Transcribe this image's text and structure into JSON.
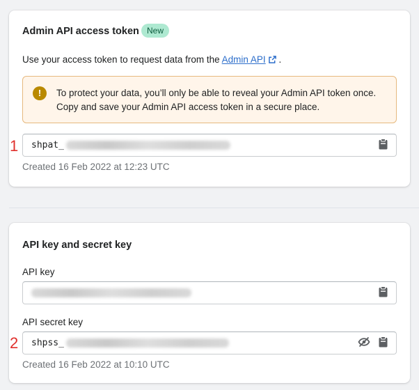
{
  "admin_token": {
    "title": "Admin API access token",
    "badge": "New",
    "description_prefix": "Use your access token to request data from the ",
    "description_link": "Admin API",
    "description_suffix": " .",
    "banner_text": "To protect your data, you’ll only be able to reveal your Admin API token once. Copy and save your Admin API access token in a secure place.",
    "token_prefix": "shpat_",
    "created": "Created 16 Feb 2022 at 12:23 UTC",
    "annotation": "1"
  },
  "api_keys": {
    "title": "API key and secret key",
    "api_key_label": "API key",
    "secret_key_label": "API secret key",
    "secret_prefix": "shpss_",
    "created": "Created 16 Feb 2022 at 10:10 UTC",
    "annotation": "2"
  },
  "icons": {
    "copy": "clipboard-icon",
    "hide": "eye-slash-icon",
    "external": "external-link-icon",
    "warning": "exclamation-circle-icon"
  },
  "colors": {
    "badge_bg": "#aee9d1",
    "banner_bg": "#fff5ea",
    "banner_border": "#e6b97e",
    "link": "#2c6ecb",
    "warning_icon": "#b98900",
    "annotation": "#e0302c"
  }
}
